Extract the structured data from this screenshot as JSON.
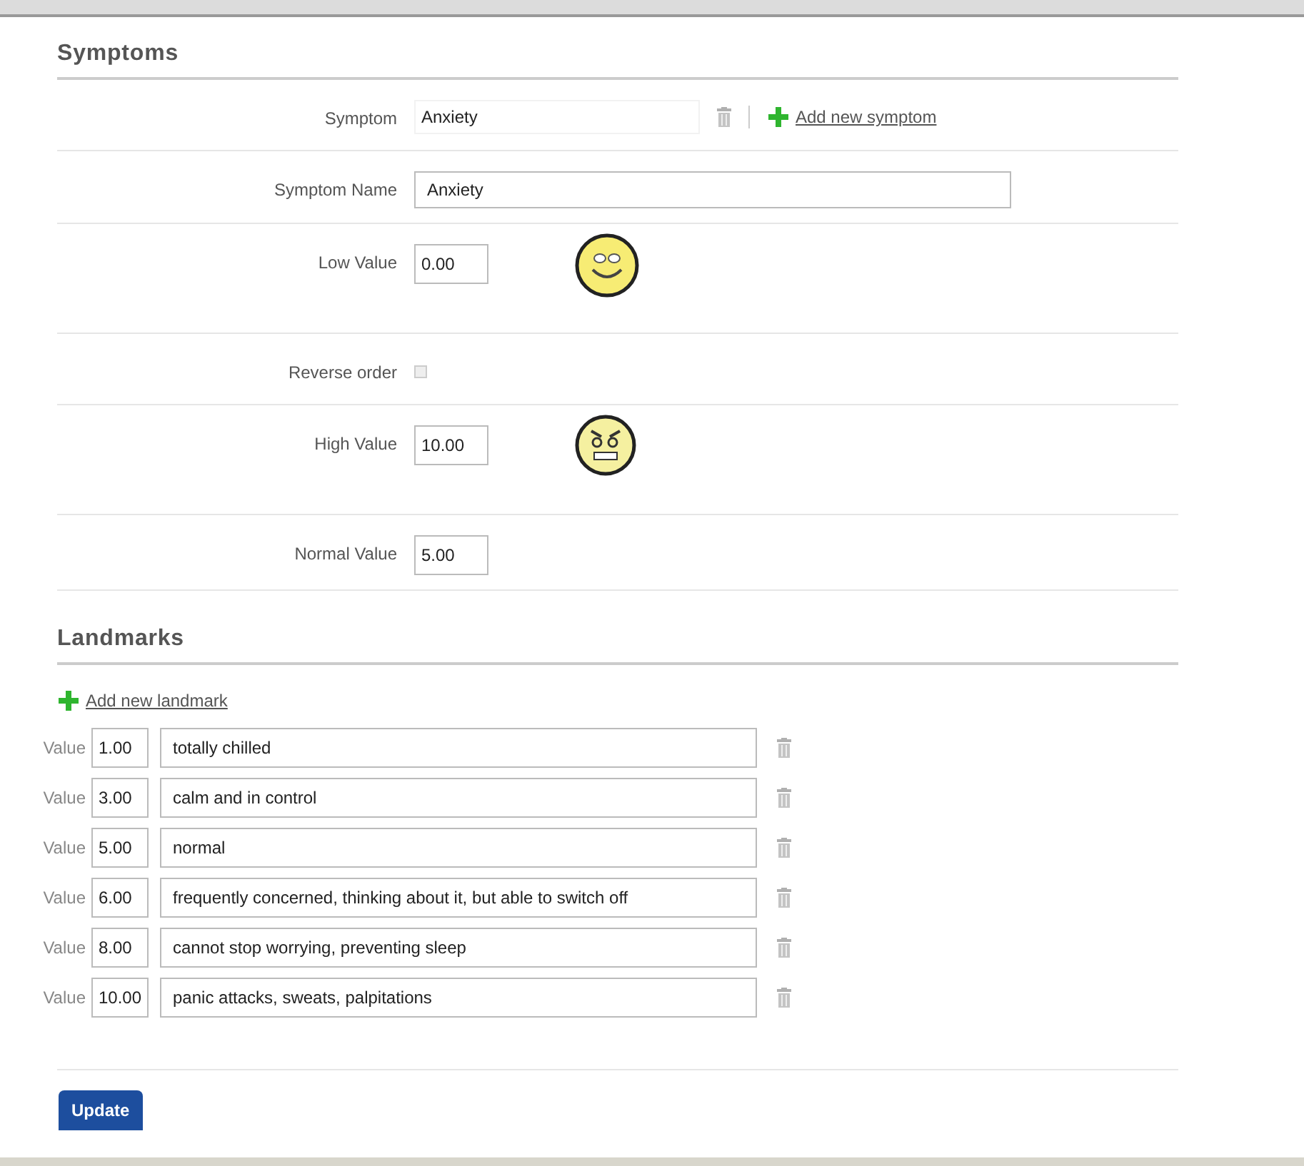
{
  "symptoms": {
    "title": "Symptoms",
    "fields": [
      {
        "kind": "select",
        "label": "Symptom",
        "value": "Anxiety",
        "add_link": "Add new symptom"
      },
      {
        "kind": "text",
        "label": "Symptom Name",
        "value": "Anxiety"
      },
      {
        "kind": "number",
        "label": "Low Value",
        "value": "0.00",
        "face": {
          "kind": "happy"
        }
      },
      {
        "kind": "checkbox",
        "label": "Reverse order",
        "checked": false
      },
      {
        "kind": "number",
        "label": "High Value",
        "value": "10.00",
        "face": {
          "kind": "stressed"
        }
      },
      {
        "kind": "number",
        "label": "Normal Value",
        "value": "5.00"
      }
    ]
  },
  "landmarks": {
    "title": "Landmarks",
    "add_link": "Add new landmark",
    "rows": [
      {
        "label": "Value",
        "value": "1.00",
        "description": "totally chilled"
      },
      {
        "label": "Value",
        "value": "3.00",
        "description": "calm and in control"
      },
      {
        "label": "Value",
        "value": "5.00",
        "description": "normal"
      },
      {
        "label": "Value",
        "value": "6.00",
        "description": "frequently concerned, thinking about it, but able to switch off"
      },
      {
        "label": "Value",
        "value": "8.00",
        "description": "cannot stop worrying, preventing sleep"
      },
      {
        "label": "Value",
        "value": "10.00",
        "description": "panic attacks, sweats, palpitations"
      }
    ]
  },
  "update_button": "Update"
}
